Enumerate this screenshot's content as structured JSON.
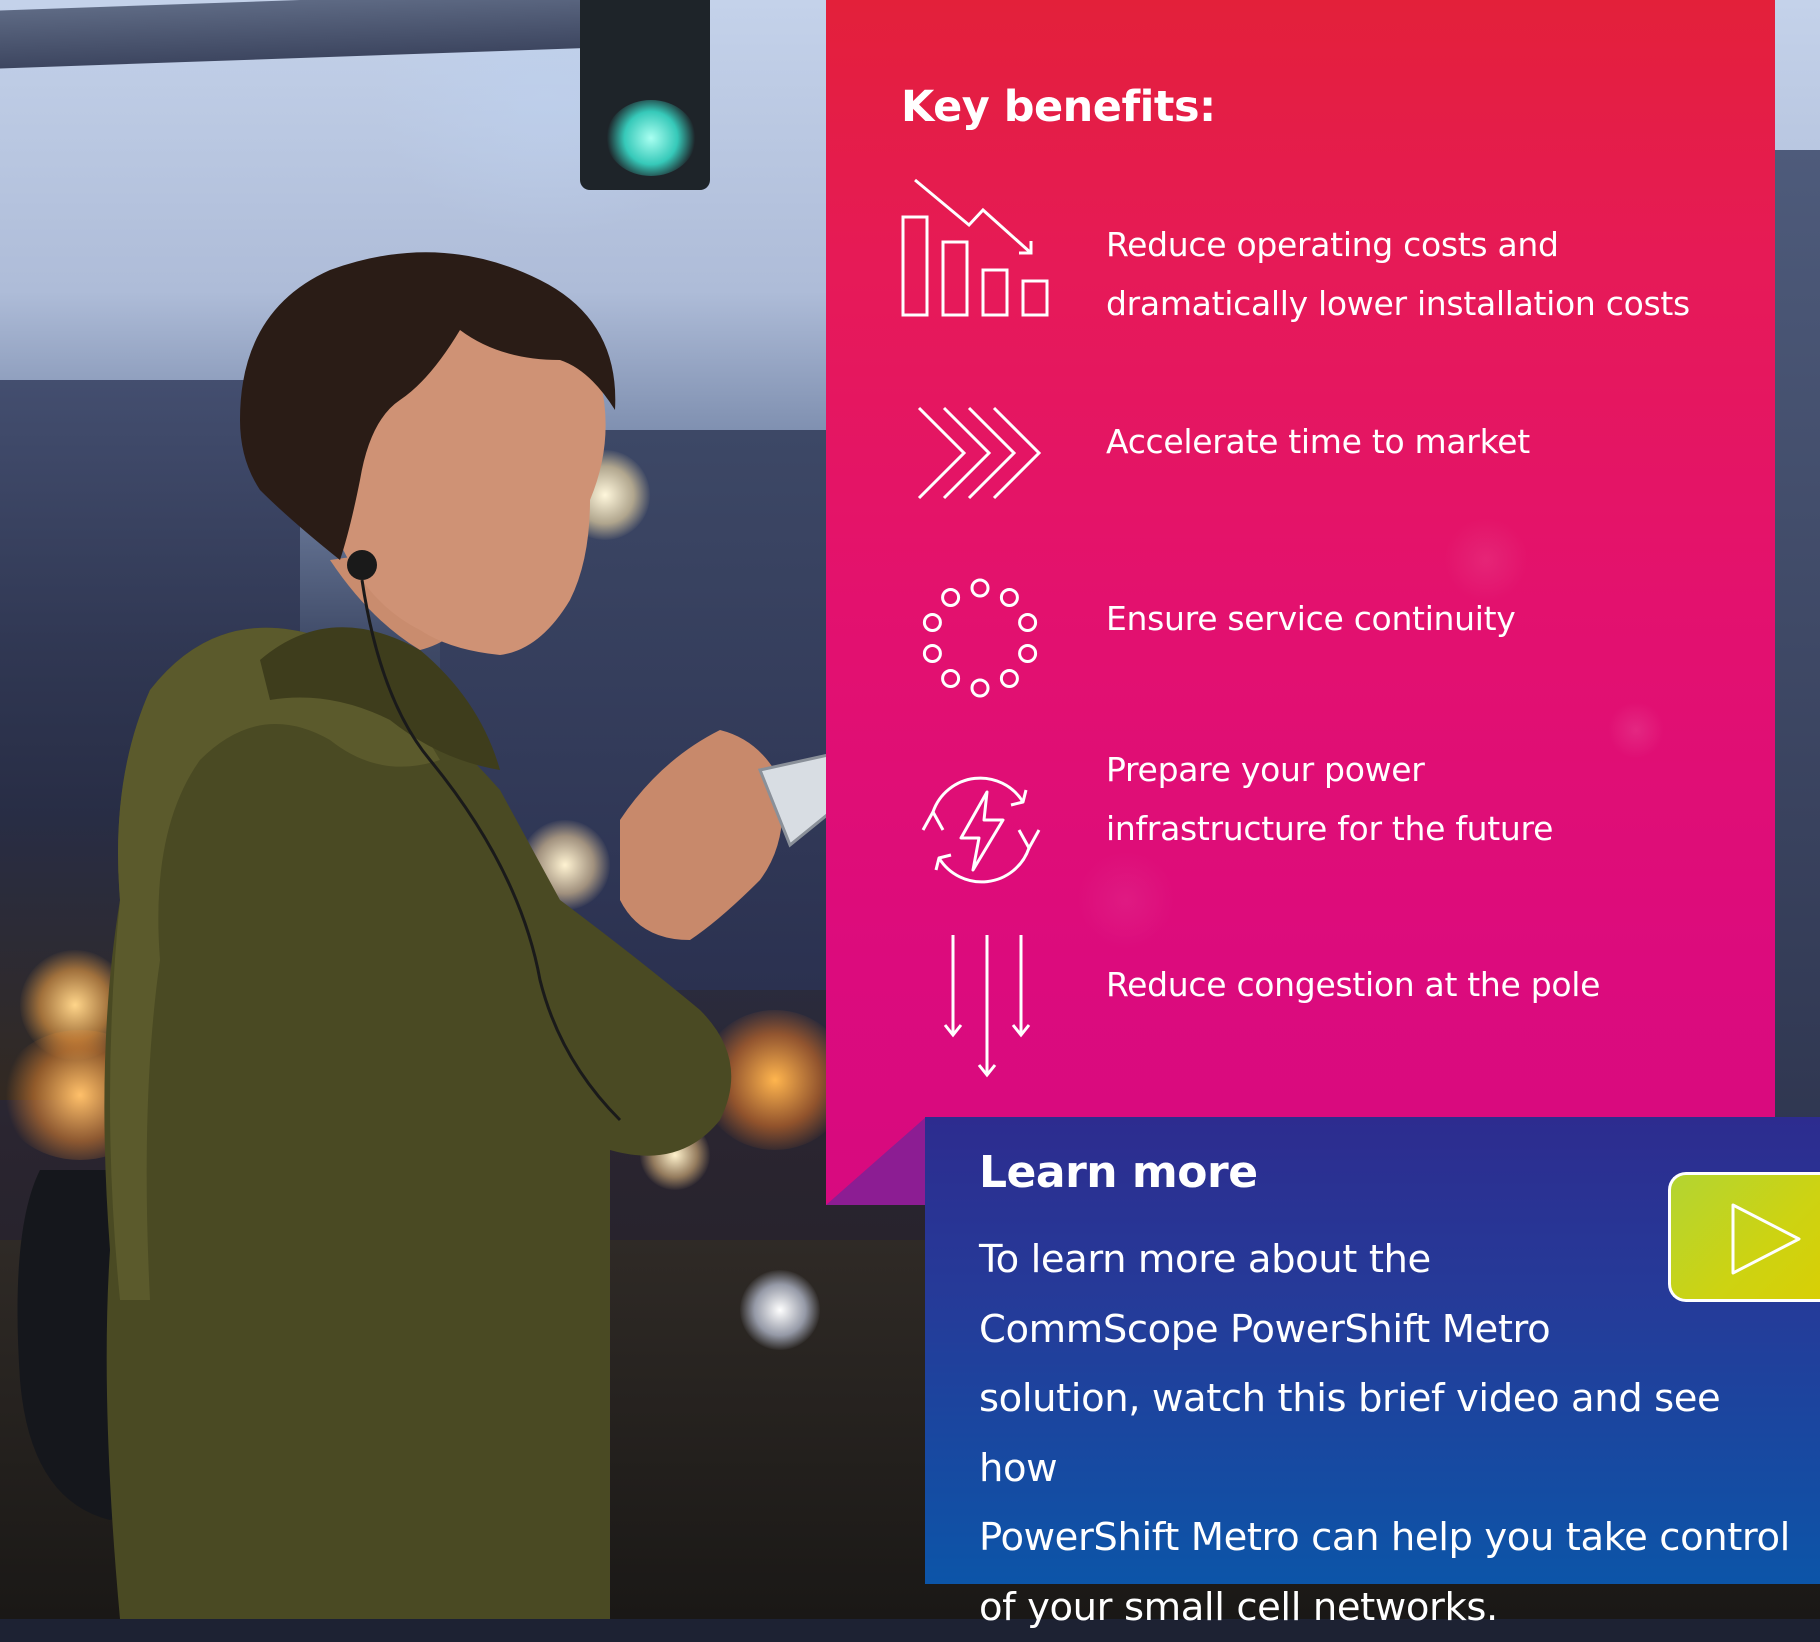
{
  "benefits_panel": {
    "title": "Key benefits:",
    "items": [
      {
        "icon": "declining-bar-chart-icon",
        "lines": [
          "Reduce operating costs and",
          "dramatically lower installation costs"
        ]
      },
      {
        "icon": "triple-chevron-right-icon",
        "lines": [
          "Accelerate time to market"
        ]
      },
      {
        "icon": "circle-of-dots-icon",
        "lines": [
          "Ensure service continuity"
        ]
      },
      {
        "icon": "power-refresh-icon",
        "lines": [
          "Prepare your power",
          "infrastructure for the future"
        ]
      },
      {
        "icon": "down-arrows-icon",
        "lines": [
          "Reduce congestion at the pole"
        ]
      }
    ]
  },
  "learn_more": {
    "title": "Learn more",
    "body_lines": [
      "To learn more about the",
      "CommScope PowerShift Metro",
      "solution, watch this brief video and see how",
      "PowerShift Metro can help you take control",
      "of your small cell networks."
    ],
    "play_icon": "play-icon"
  },
  "colors": {
    "panel_top": "#e3203a",
    "panel_bottom": "#d70a7f",
    "learn_more_top": "#2d2c8f",
    "learn_more_bottom": "#0c55a8",
    "play_button": "#c8d41a"
  }
}
